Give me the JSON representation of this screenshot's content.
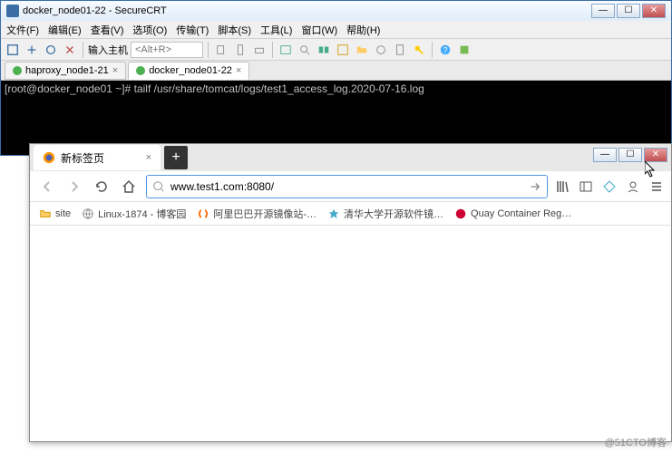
{
  "securecrt": {
    "title": "docker_node01-22 - SecureCRT",
    "menu": [
      "文件(F)",
      "编辑(E)",
      "查看(V)",
      "选项(O)",
      "传输(T)",
      "脚本(S)",
      "工具(L)",
      "窗口(W)",
      "帮助(H)"
    ],
    "host_label": "输入主机",
    "host_placeholder": "<Alt+R>",
    "tabs": [
      {
        "label": "haproxy_node1-21",
        "active": false
      },
      {
        "label": "docker_node01-22",
        "active": true
      }
    ],
    "terminal_line": "[root@docker_node01 ~]# tailf /usr/share/tomcat/logs/test1_access_log.2020-07-16.log"
  },
  "firefox": {
    "tab_label": "新标签页",
    "url": "www.test1.com:8080/",
    "bookmarks": [
      {
        "label": "site",
        "icon": "folder"
      },
      {
        "label": "Linux-1874 - 博客园",
        "icon": "globe"
      },
      {
        "label": "阿里巴巴开源镜像站-…",
        "icon": "bracket"
      },
      {
        "label": "清华大学开源软件镜…",
        "icon": "star"
      },
      {
        "label": "Quay Container Reg…",
        "icon": "quay"
      }
    ]
  },
  "watermark": "@51CTO博客"
}
